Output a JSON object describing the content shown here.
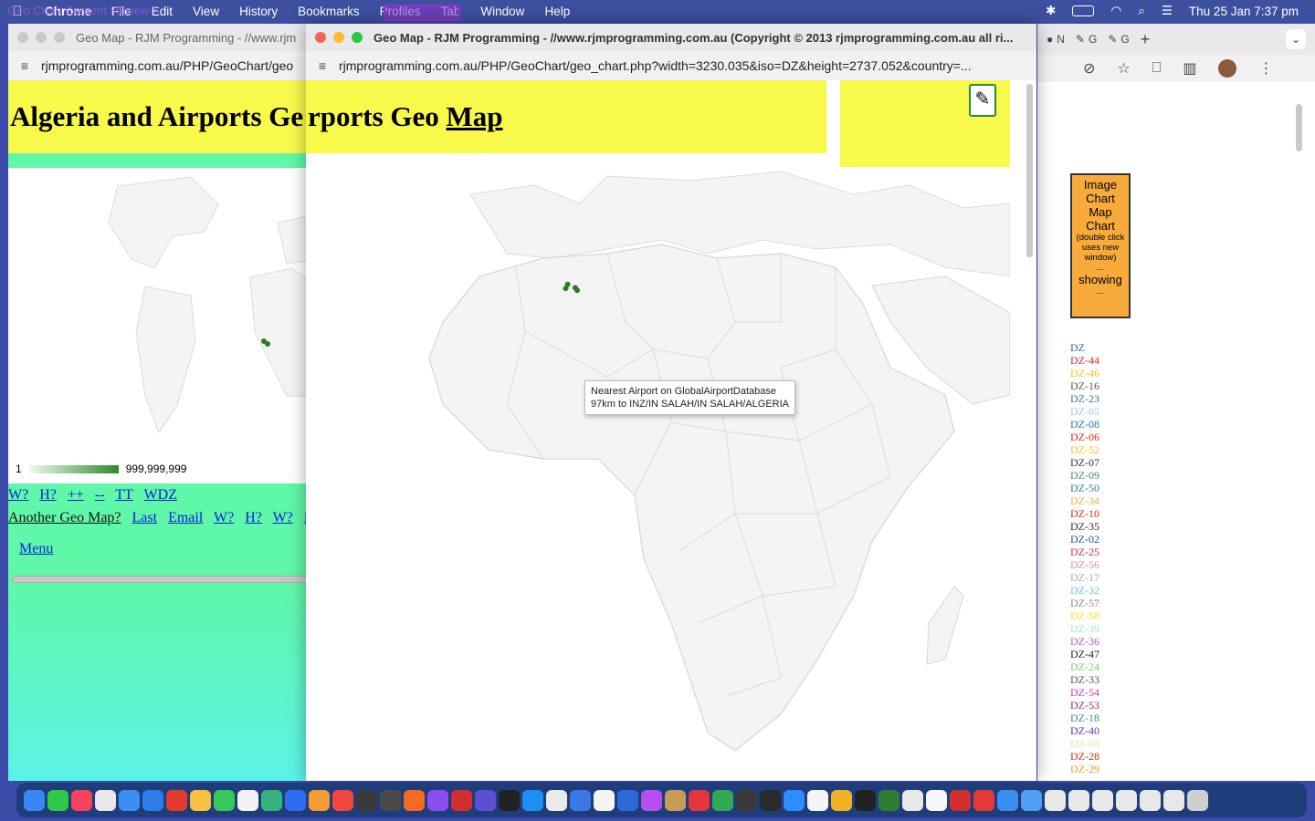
{
  "menubar": {
    "ghost_text": "Geo Chart Content Review 5",
    "app_name": "Chrome",
    "items": [
      "File",
      "Edit",
      "View",
      "History",
      "Bookmarks",
      "Profiles",
      "Tab",
      "Window",
      "Help"
    ],
    "clock": "Thu 25 Jan  7:37 pm"
  },
  "window_left": {
    "title": "Geo Map - RJM Programming - //www.rjm",
    "url": "rjmprogramming.com.au/PHP/GeoChart/geo",
    "heading_main": "Algeria and Airports Ge",
    "legend_min": "1",
    "legend_max": "999,999,999",
    "links_row1": [
      "W?",
      "H?",
      "++",
      "--",
      "TT",
      "WDZ"
    ],
    "links_row2_plain": "Another Geo Map?",
    "links_row2": [
      "Last",
      "Email",
      "W?",
      "H?",
      "W?",
      "H"
    ],
    "menu_link": "Menu"
  },
  "window_front": {
    "title": "Geo Map - RJM Programming - //www.rjmprogramming.com.au (Copyright © 2013 rjmprogramming.com.au all ri...",
    "url": "rjmprogramming.com.au/PHP/GeoChart/geo_chart.php?width=3230.035&iso=DZ&height=2737.052&country=...",
    "heading_pre": "rports Geo ",
    "heading_link": "Map",
    "tooltip_line1": "Nearest Airport on GlobalAirportDatabase",
    "tooltip_line2": "97km to INZ/IN SALAH/IN SALAH/ALGERIA"
  },
  "window_right": {
    "tabs": [
      "N",
      "G",
      "G"
    ],
    "chart_box": {
      "line1": "Image",
      "line2": "Chart",
      "line3": "Map",
      "line4": "Chart",
      "note": "(double click uses new window)",
      "dots": "...",
      "status": "showing",
      "dots2": "..."
    },
    "codes": [
      {
        "code": "DZ",
        "color": "#3a5bbf"
      },
      {
        "code": "DZ-44",
        "color": "#e0262a"
      },
      {
        "code": "DZ-46",
        "color": "#f1c21b"
      },
      {
        "code": "DZ-16",
        "color": "#555555"
      },
      {
        "code": "DZ-23",
        "color": "#3b7a9a"
      },
      {
        "code": "DZ-05",
        "color": "#a9c3d0"
      },
      {
        "code": "DZ-08",
        "color": "#2b6fb5"
      },
      {
        "code": "DZ-06",
        "color": "#d8281e"
      },
      {
        "code": "DZ-52",
        "color": "#f1c21b"
      },
      {
        "code": "DZ-07",
        "color": "#333333"
      },
      {
        "code": "DZ-09",
        "color": "#3f8f6a"
      },
      {
        "code": "DZ-50",
        "color": "#2e7f8a"
      },
      {
        "code": "DZ-34",
        "color": "#e6b33a"
      },
      {
        "code": "DZ-10",
        "color": "#d8281e"
      },
      {
        "code": "DZ-35",
        "color": "#333333"
      },
      {
        "code": "DZ-02",
        "color": "#2b4f9a"
      },
      {
        "code": "DZ-25",
        "color": "#d8284e"
      },
      {
        "code": "DZ-56",
        "color": "#e48bb0"
      },
      {
        "code": "DZ-17",
        "color": "#aaaaaa"
      },
      {
        "code": "DZ-32",
        "color": "#58d0d8"
      },
      {
        "code": "DZ-57",
        "color": "#8a8a8a"
      },
      {
        "code": "DZ-58",
        "color": "#f4e11c"
      },
      {
        "code": "DZ-39",
        "color": "#9fe8d0"
      },
      {
        "code": "DZ-36",
        "color": "#c853b8"
      },
      {
        "code": "DZ-47",
        "color": "#222222"
      },
      {
        "code": "DZ-24",
        "color": "#7fc96a"
      },
      {
        "code": "DZ-33",
        "color": "#555555"
      },
      {
        "code": "DZ-54",
        "color": "#c83ab0"
      },
      {
        "code": "DZ-53",
        "color": "#a02a6a"
      },
      {
        "code": "DZ-18",
        "color": "#3f8f6a"
      },
      {
        "code": "DZ-40",
        "color": "#6a2ac8"
      },
      {
        "code": "DZ-03",
        "color": "#f0d9a8"
      },
      {
        "code": "DZ-28",
        "color": "#d8281e"
      },
      {
        "code": "DZ-29",
        "color": "#d9a41e"
      }
    ]
  },
  "map_markers": [
    {
      "lat": 27.7,
      "lon": 2.8
    },
    {
      "lat": 26.9,
      "lon": 2.4
    },
    {
      "lat": 27.0,
      "lon": 4.4
    },
    {
      "lat": 26.5,
      "lon": 4.8
    }
  ],
  "colors": {
    "yellow": "#f8f94a",
    "green_page": "#5ff7a8",
    "link_blue": "#0a1fd6",
    "chart_box_orange": "#f8ab3a",
    "marker_green": "#2d7a25"
  }
}
